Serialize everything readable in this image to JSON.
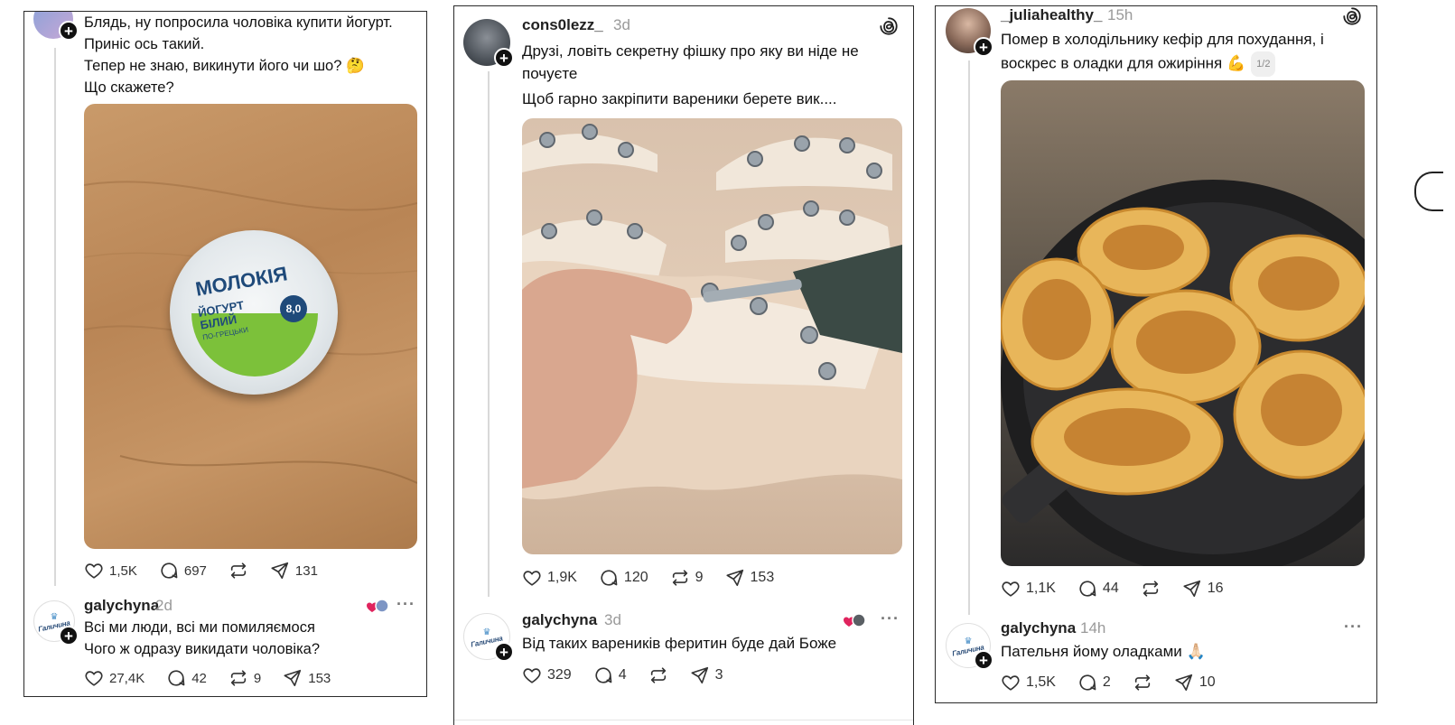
{
  "posts": [
    {
      "username": "",
      "time": "",
      "lines": [
        "Блядь, ну попросила чоловіка купити йогурт.",
        "Приніс ось такий.",
        "Тепер не знаю, викинути його чи шо? 🤔",
        "Що скажете?"
      ],
      "image_alt": "yogurt cup on wooden table",
      "yogurt_label": {
        "brand": "МОЛОКІЯ",
        "product": "ЙОГУРТ БІЛИЙ",
        "sub": "ПО-ГРЕЦЬКИ",
        "fat": "8,0"
      },
      "actions": {
        "likes": "1,5K",
        "comments": "697",
        "reposts": "",
        "shares": "131"
      },
      "reply": {
        "username": "galychyna",
        "time": "2d",
        "lines": [
          "Всі ми люди, всі ми помиляємося",
          "Чого ж одразу викидати чоловіка?"
        ],
        "actions": {
          "likes": "27,4K",
          "comments": "42",
          "reposts": "9",
          "shares": "153"
        }
      }
    },
    {
      "username": "cons0lezz_",
      "time": "3d",
      "lines": [
        "Друзі, ловіть секретну фішку про яку ви ніде не почуєте",
        "Щоб гарно закріпити вареники берете вик...."
      ],
      "image_alt": "dumplings fastened with screws",
      "actions": {
        "likes": "1,9K",
        "comments": "120",
        "reposts": "9",
        "shares": "153"
      },
      "reply": {
        "username": "galychyna",
        "time": "3d",
        "lines": [
          "Від таких вареників феритин буде дай Боже"
        ],
        "actions": {
          "likes": "329",
          "comments": "4",
          "reposts": "",
          "shares": "3"
        }
      }
    },
    {
      "username": "_juliahealthy_",
      "time": "15h",
      "lines": [
        "Помер в холодільнику кефір для похудання, і воскрес в оладки для ожиріння 💪"
      ],
      "pager": "1/2",
      "image_alt": "pancakes frying in a pan",
      "actions": {
        "likes": "1,1K",
        "comments": "44",
        "reposts": "",
        "shares": "16"
      },
      "reply": {
        "username": "galychyna",
        "time": "14h",
        "lines": [
          "Пательня йому оладками 🙏🏻"
        ],
        "actions": {
          "likes": "1,5K",
          "comments": "2",
          "reposts": "",
          "shares": "10"
        }
      }
    }
  ],
  "brand_avatar": {
    "name": "Галичина",
    "tagline": "з натури від"
  },
  "icons": [
    "heart-icon",
    "comment-icon",
    "repost-icon",
    "share-icon",
    "plus-icon",
    "threads-logo-icon",
    "more-icon"
  ],
  "colors": {
    "line": "#d9d9d9",
    "muted": "#9a9a9a",
    "brand_blue": "#2d4f7a"
  }
}
